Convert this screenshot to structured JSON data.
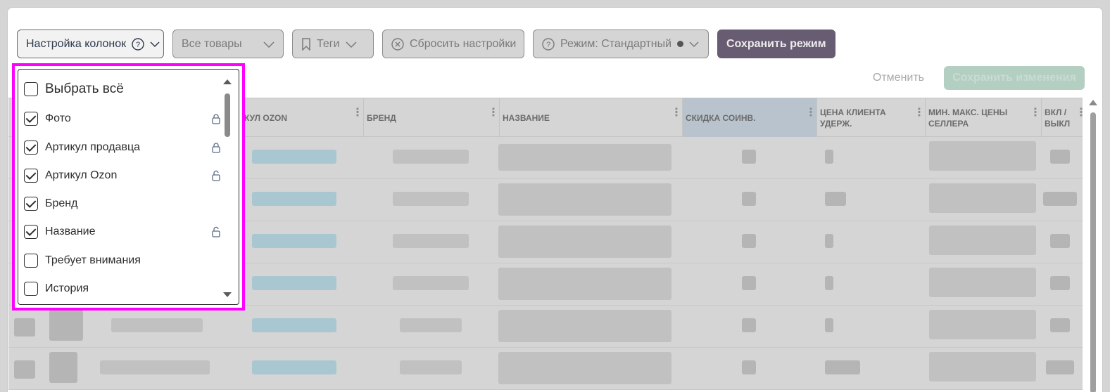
{
  "toolbar": {
    "column_settings": "Настройка колонок",
    "all_products": "Все товары",
    "tags": "Теги",
    "reset_settings": "Сбросить настройки",
    "mode": "Режим: Стандартный",
    "save_mode": "Сохранить режим"
  },
  "actions": {
    "cancel": "Отменить",
    "save_changes": "Сохранить изменения"
  },
  "table": {
    "columns": [
      "КУЛ OZON",
      "БРЕНД",
      "НАЗВАНИЕ",
      "СКИДКА СОИНВ.",
      "ЦЕНА КЛИЕНТА УДЕРЖ.",
      "МИН. МАКС. ЦЕНЫ СЕЛЛЕРА",
      "ВКЛ / ВЫКЛ"
    ]
  },
  "dropdown": {
    "select_all": "Выбрать всё",
    "items": [
      {
        "label": "Фото",
        "checked": true,
        "lock": "locked"
      },
      {
        "label": "Артикул продавца",
        "checked": true,
        "lock": "locked"
      },
      {
        "label": "Артикул Ozon",
        "checked": true,
        "lock": "unlocked"
      },
      {
        "label": "Бренд",
        "checked": true,
        "lock": ""
      },
      {
        "label": "Название",
        "checked": true,
        "lock": "unlocked"
      },
      {
        "label": "Требует внимания",
        "checked": false,
        "lock": ""
      },
      {
        "label": "История",
        "checked": false,
        "lock": ""
      }
    ]
  },
  "colors": {
    "highlight": "#ff00ff",
    "save_mode_bg": "#685c72",
    "save_changes_bg": "#b3cfc2"
  }
}
